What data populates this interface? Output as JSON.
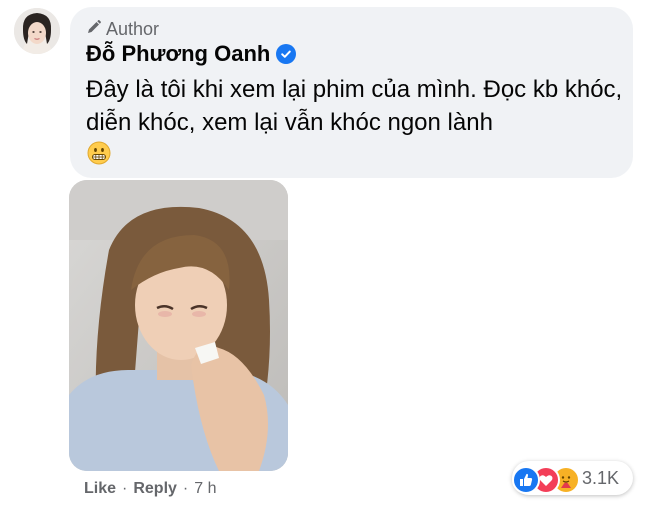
{
  "comment": {
    "author_badge": "Author",
    "author_name": "Đỗ Phương Oanh",
    "text": "Đây là tôi khi xem lại phim của mình. Đọc kb khóc, diễn khóc, xem lại vẫn khóc ngon lành",
    "emoji": "grimacing-face"
  },
  "actions": {
    "like": "Like",
    "sep1": "·",
    "reply": "Reply",
    "sep2": "·",
    "time": "7 h"
  },
  "reactions": {
    "icons": [
      "like-icon",
      "love-icon",
      "care-icon"
    ],
    "count": "3.1K"
  },
  "colors": {
    "bubble": "#f0f2f5",
    "verified": "#1877f2",
    "secondary_text": "#65676b",
    "primary_text": "#050505"
  }
}
